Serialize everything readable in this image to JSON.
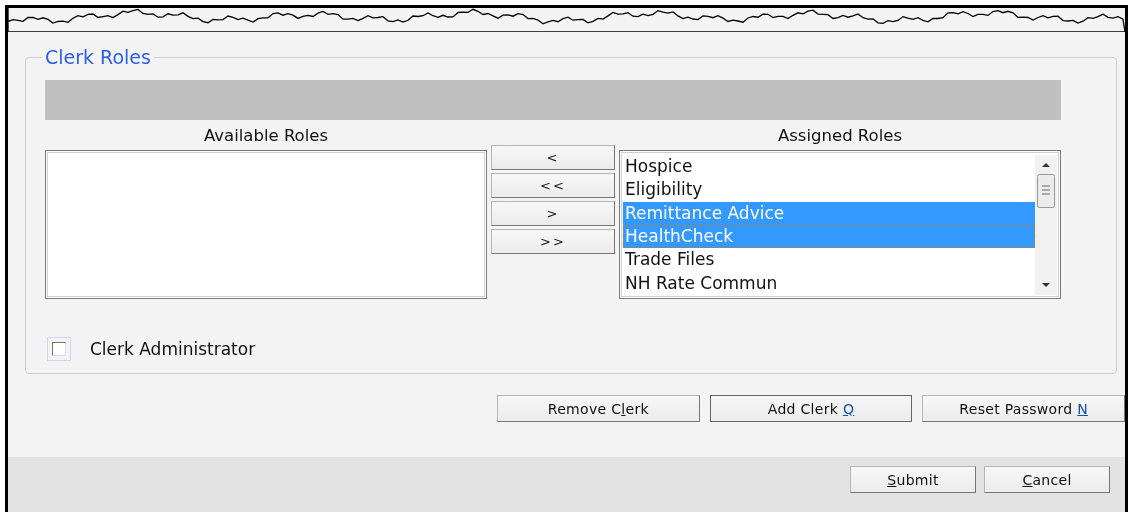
{
  "section": {
    "title": "Clerk Roles"
  },
  "available_roles": {
    "heading": "Available Roles"
  },
  "transfer_buttons": [
    "<",
    "<<",
    ">",
    ">>"
  ],
  "assigned_roles": {
    "heading": "Assigned Roles",
    "items": [
      {
        "label": "Hospice",
        "selected": false,
        "focused": false
      },
      {
        "label": "Eligibility",
        "selected": false,
        "focused": false
      },
      {
        "label": "Remittance Advice",
        "selected": true,
        "focused": false
      },
      {
        "label": "HealthCheck",
        "selected": true,
        "focused": true
      },
      {
        "label": "Trade Files",
        "selected": false,
        "focused": false
      },
      {
        "label": "NH Rate Commun",
        "selected": false,
        "focused": false
      }
    ]
  },
  "clerk_administrator": {
    "label": "Clerk Administrator",
    "checked": false
  },
  "clerk_buttons": [
    {
      "before": "Remove C",
      "key": "l",
      "after": "erk",
      "key_link": false,
      "default": false
    },
    {
      "before": "Add Clerk ",
      "key": "Q",
      "key_link": true,
      "default": true
    },
    {
      "before": "Reset Password ",
      "key": "N",
      "key_link": true,
      "default": false
    }
  ],
  "footer_buttons": [
    {
      "key": "S",
      "after": "ubmit",
      "key_link": false,
      "default": false
    },
    {
      "key": "C",
      "after": "ancel",
      "key_link": false,
      "default": false
    }
  ]
}
